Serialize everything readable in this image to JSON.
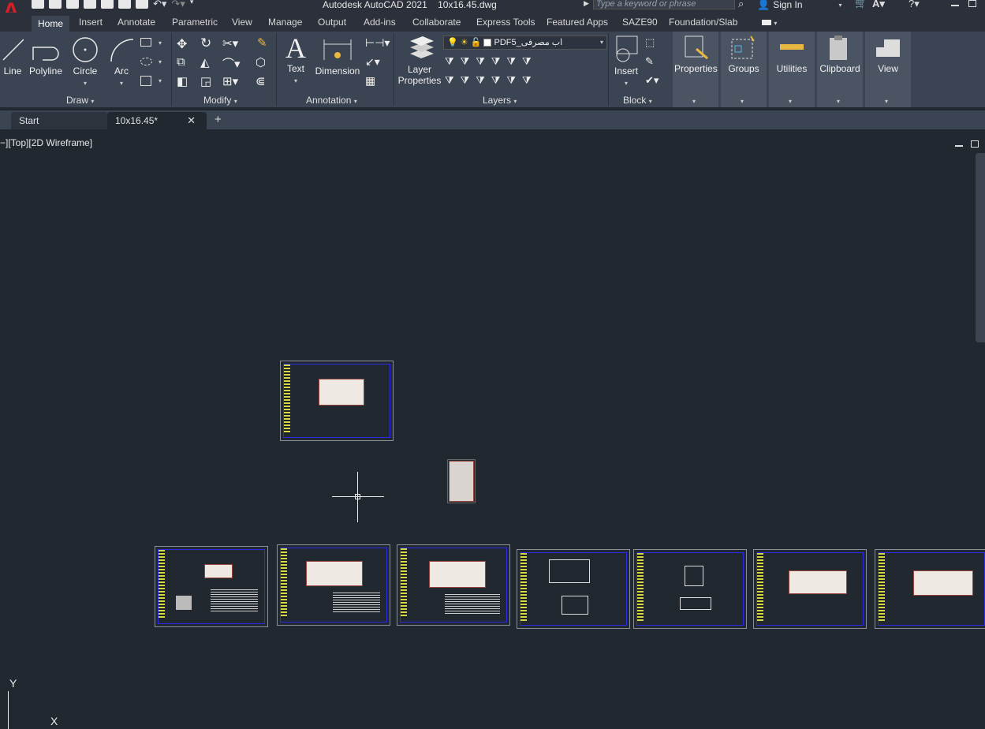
{
  "app": {
    "logo": "A",
    "title": "Autodesk AutoCAD 2021",
    "filename": "10x16.45.dwg"
  },
  "search": {
    "placeholder": "Type a keyword or phrase"
  },
  "account": {
    "sign_in": "Sign In"
  },
  "ribbon_tabs": [
    "Home",
    "Insert",
    "Annotate",
    "Parametric",
    "View",
    "Manage",
    "Output",
    "Add-ins",
    "Collaborate",
    "Express Tools",
    "Featured Apps",
    "SAZE90",
    "Foundation/Slab"
  ],
  "draw": {
    "title": "Draw",
    "line": "Line",
    "polyline": "Polyline",
    "circle": "Circle",
    "arc": "Arc"
  },
  "modify": {
    "title": "Modify"
  },
  "annotation": {
    "title": "Annotation",
    "text": "Text",
    "dimension": "Dimension"
  },
  "layers": {
    "title": "Layers",
    "layer_properties_1": "Layer",
    "layer_properties_2": "Properties",
    "current_layer": "PDF5_اب مصرفی"
  },
  "block": {
    "title": "Block",
    "insert": "Insert"
  },
  "properties": {
    "label": "Properties"
  },
  "groups": {
    "label": "Groups"
  },
  "utilities": {
    "label": "Utilities"
  },
  "clipboard": {
    "label": "Clipboard"
  },
  "view": {
    "label": "View"
  },
  "doc_tabs": {
    "start": "Start",
    "file": "10x16.45*"
  },
  "viewport": {
    "label": "−][Top][2D Wireframe]"
  },
  "ucs": {
    "y": "Y",
    "x": "X"
  },
  "colors": {
    "accent_red": "#d81f26",
    "viewport_bg": "#212830",
    "ribbon_bg": "#3b4452",
    "frame_blue": "#2c2ce8"
  }
}
